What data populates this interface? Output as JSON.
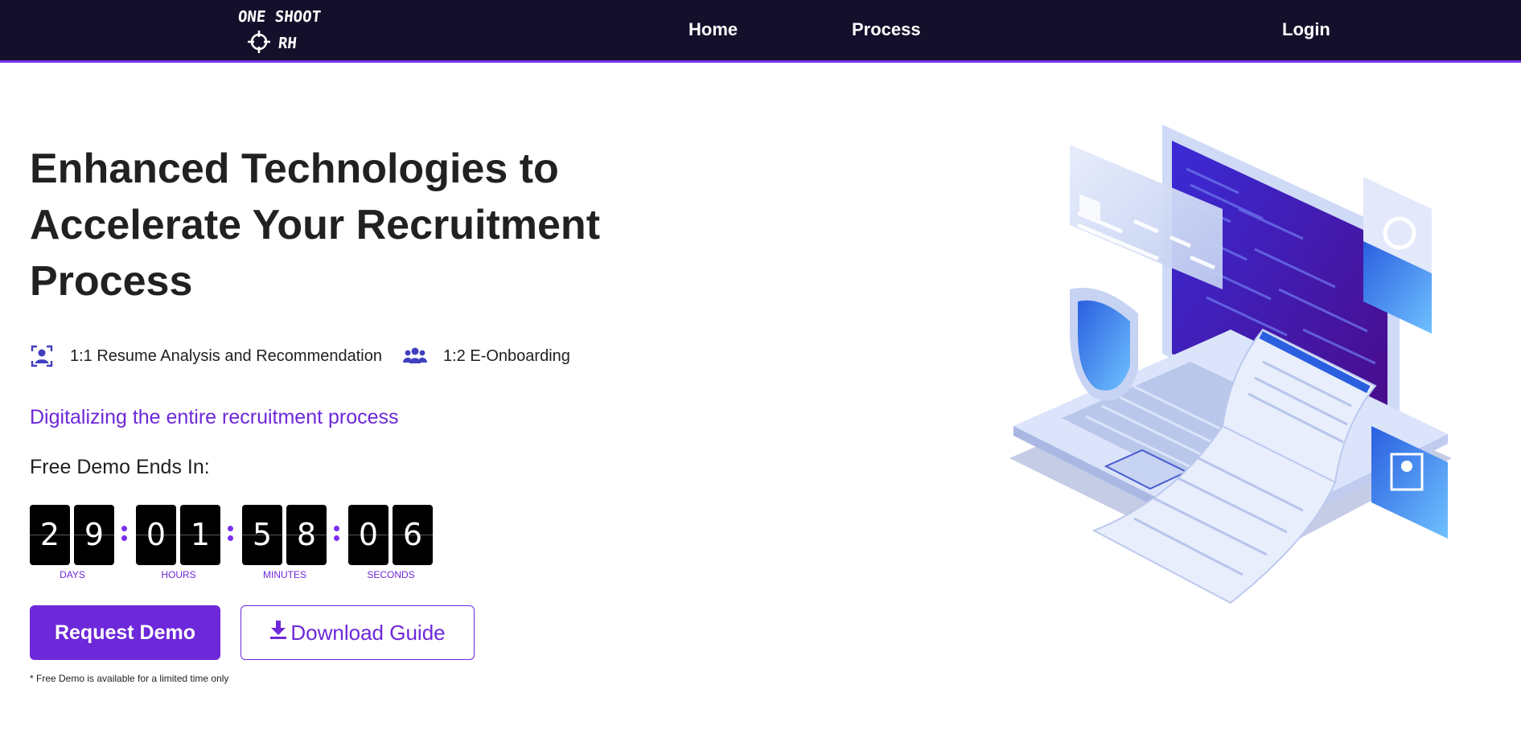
{
  "nav": {
    "logo_line1": "ONE SHOOT",
    "logo_line2": "RH",
    "logo_icon": "crosshair-icon",
    "links": [
      {
        "label": "Home"
      },
      {
        "label": "Process"
      },
      {
        "label": "Login"
      }
    ]
  },
  "hero": {
    "headline_line1": "Enhanced Technologies to",
    "headline_line2": "Accelerate Your Recruitment",
    "headline_line3": "Process",
    "features": [
      {
        "icon": "user-focus-icon",
        "label": "1:1 Resume Analysis and Recommendation"
      },
      {
        "icon": "users-group-icon",
        "label": "1:2 E-Onboarding"
      }
    ],
    "subtitle": "Digitalizing the entire recruitment process",
    "demo_ends_label": "Free Demo Ends In:"
  },
  "countdown": {
    "days": [
      "2",
      "9"
    ],
    "hours": [
      "0",
      "1"
    ],
    "minutes": [
      "5",
      "8"
    ],
    "seconds": [
      "0",
      "6"
    ],
    "labels": {
      "days": "DAYS",
      "hours": "HOURS",
      "minutes": "MINUTES",
      "seconds": "SECONDS"
    }
  },
  "actions": {
    "request_demo": "Request Demo",
    "download_guide": "Download Guide",
    "download_icon": "download-icon"
  },
  "footnote": "* Free Demo is available for a limited time only",
  "colors": {
    "navbar_bg": "#14102b",
    "accent": "#6d28d9",
    "nav_border": "#7b2ff0"
  },
  "illustration": {
    "icon": "laptop-security-illustration"
  }
}
